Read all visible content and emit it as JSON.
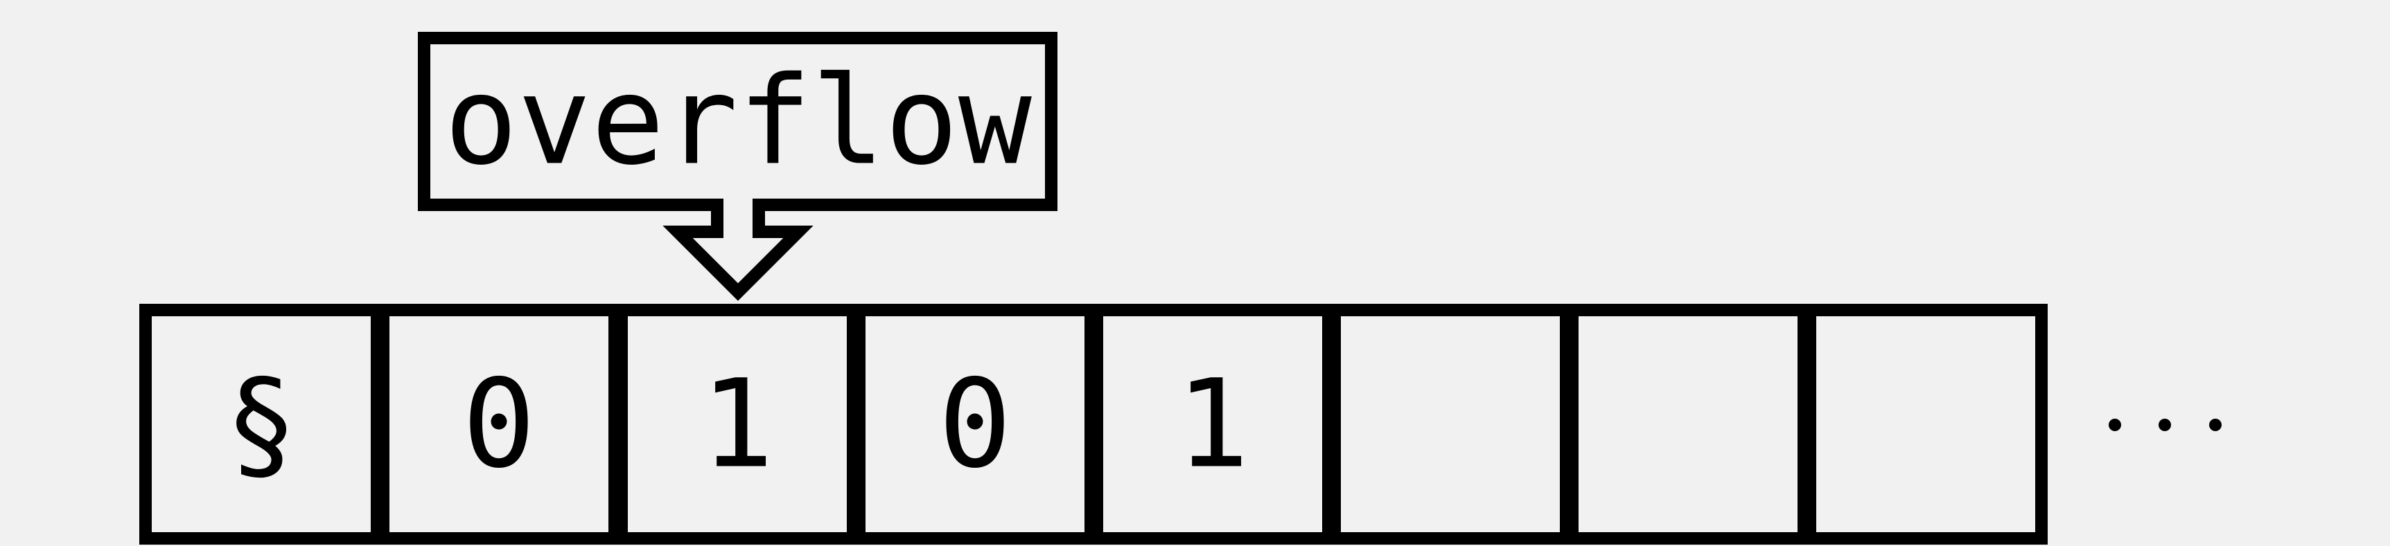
{
  "callout": {
    "text": "overflow",
    "target_cell_index": 2
  },
  "tape": {
    "cells": [
      {
        "symbol": "§"
      },
      {
        "symbol": "0"
      },
      {
        "symbol": "1"
      },
      {
        "symbol": "0"
      },
      {
        "symbol": "1"
      },
      {
        "symbol": ""
      },
      {
        "symbol": ""
      },
      {
        "symbol": ""
      }
    ],
    "continuation": "…"
  },
  "colors": {
    "background": "#f1f1f1",
    "stroke": "#000000",
    "text": "#000000"
  }
}
